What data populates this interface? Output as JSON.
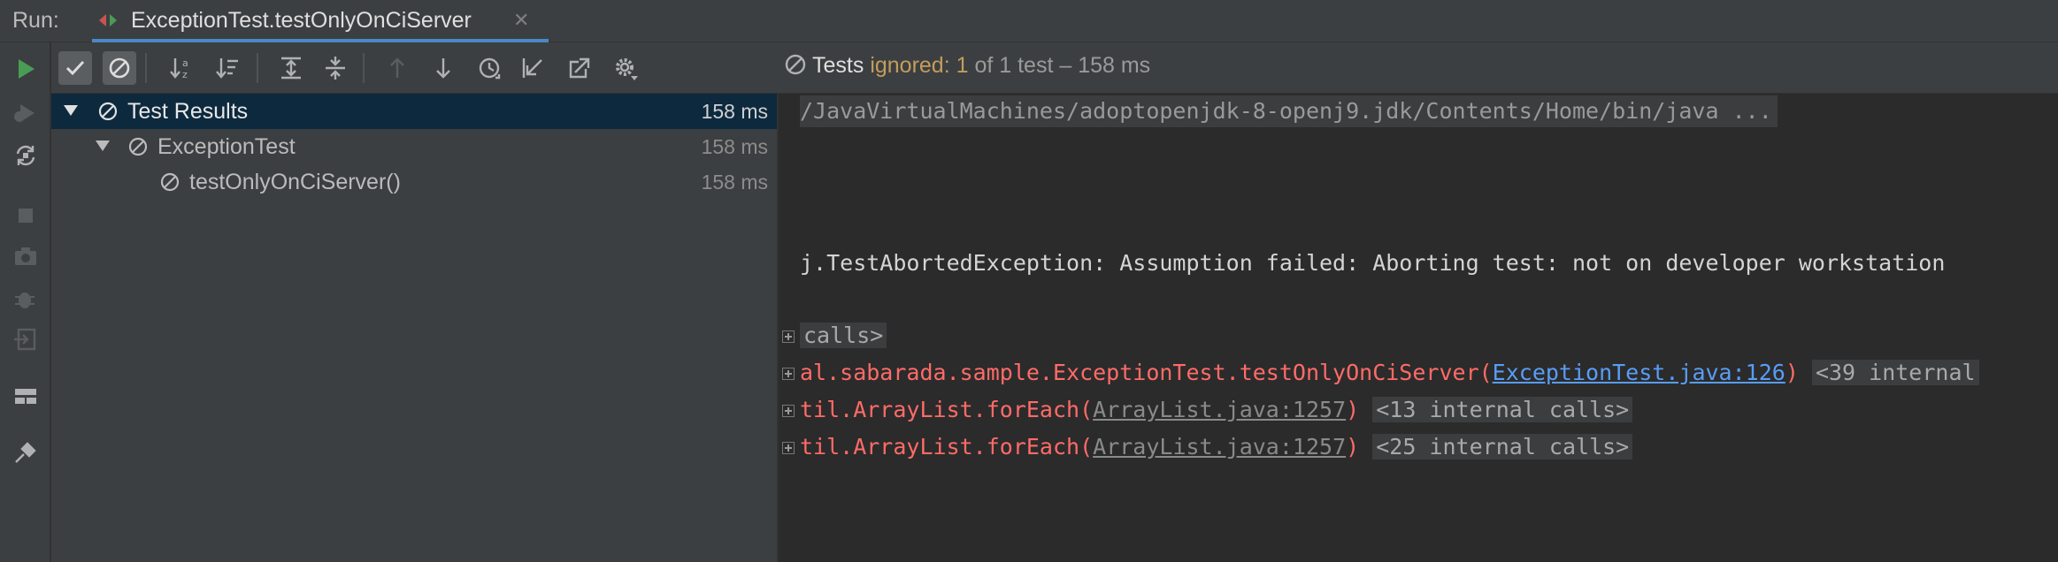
{
  "header": {
    "run_label": "Run:",
    "tab_title": "ExceptionTest.testOnlyOnCiServer",
    "close_glyph": "✕"
  },
  "sidebar": {
    "buttons": [
      "rerun-icon",
      "rerun-failed-icon",
      "toggle-auto-test-icon",
      "stop-icon",
      "screenshot-icon",
      "debug-icon",
      "exit-icon",
      "layout-icon",
      "pin-icon"
    ]
  },
  "toolbar": {
    "buttons": [
      "show-passed-icon",
      "show-ignored-icon",
      "sort-alphabetically-icon",
      "sort-by-duration-icon",
      "expand-all-icon",
      "collapse-all-icon",
      "previous-failed-icon",
      "next-failed-icon",
      "test-history-icon",
      "import-tests-icon",
      "export-tests-icon",
      "settings-icon"
    ]
  },
  "status": {
    "tests_label": "Tests",
    "ignored_text": "ignored: 1",
    "rest_text": "of 1 test – 158 ms"
  },
  "tree": {
    "rows": [
      {
        "label": "Test Results",
        "time": "158 ms"
      },
      {
        "label": "ExceptionTest",
        "time": "158 ms"
      },
      {
        "label": "testOnlyOnCiServer()",
        "time": "158 ms"
      }
    ]
  },
  "console": {
    "command": "/JavaVirtualMachines/adoptopenjdk-8-openj9.jdk/Contents/Home/bin/java ...",
    "exception": "j.TestAbortedException: Assumption failed: Aborting test: not on developer workstation",
    "calls_folded": "calls>",
    "trace1_prefix": "al.sabarada.sample.ExceptionTest.testOnlyOnCiServer(",
    "trace1_link": "ExceptionTest.java:126",
    "trace1_suffix": ")",
    "trace1_folded": "<39 internal",
    "trace2_prefix": "til.ArrayList.forEach(",
    "trace2_link": "ArrayList.java:1257",
    "trace2_suffix": ")",
    "trace2_folded": "<13 internal calls>",
    "trace3_prefix": "til.ArrayList.forEach(",
    "trace3_link": "ArrayList.java:1257",
    "trace3_suffix": ")",
    "trace3_folded": "<25 internal calls>"
  },
  "colors": {
    "run_green": "#499c54",
    "ignored_orange": "#c39d5b",
    "error_red": "#ff6b68",
    "link_blue": "#589df6",
    "selection": "#0d293e"
  }
}
